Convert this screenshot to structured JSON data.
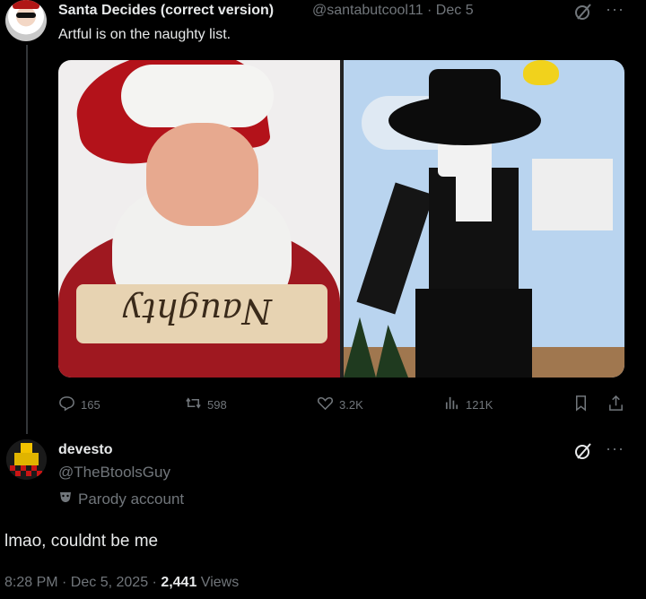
{
  "tweet": {
    "author_name": "Santa Decides (correct version)",
    "handle_date": "@santabutcool11 · Dec 5",
    "text": "Artful is on the naughty list.",
    "image_left_caption": "Naughty",
    "stats": {
      "replies": "165",
      "retweets": "598",
      "likes": "3.2K",
      "views": "121K"
    }
  },
  "reply": {
    "author_name": "devesto",
    "handle": "@TheBtoolsGuy",
    "label": "Parody account",
    "text": "lmao, couldnt be me",
    "timestamp": "8:28 PM · Dec 5, 2025 · ",
    "views_count": "2,441",
    "views_label": " Views"
  },
  "colors": {
    "background": "#000000",
    "text": "#e7e9ea",
    "muted": "#71767b"
  },
  "icons": [
    "grok-icon",
    "more-icon",
    "reply-icon",
    "retweet-icon",
    "like-icon",
    "views-icon",
    "bookmark-icon",
    "share-icon",
    "parody-mask-icon"
  ]
}
